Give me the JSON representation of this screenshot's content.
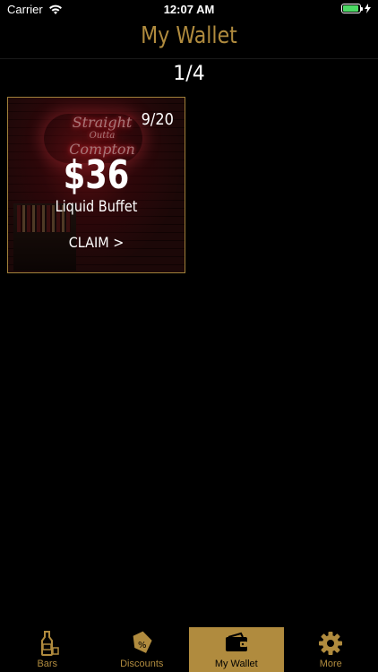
{
  "status_bar": {
    "carrier": "Carrier",
    "time": "12:07 AM"
  },
  "header": {
    "title": "My Wallet"
  },
  "pager": {
    "text": "1/4"
  },
  "coupon": {
    "count": "9/20",
    "amount": "$36",
    "name": "Liquid Buffet",
    "claim_label": "CLAIM >",
    "neon_line1": "Straight",
    "neon_line2": "Outta",
    "neon_line3": "Compton"
  },
  "tabs": [
    {
      "label": "Bars",
      "icon": "bottle-icon"
    },
    {
      "label": "Discounts",
      "icon": "discount-tag-icon"
    },
    {
      "label": "My Wallet",
      "icon": "wallet-icon"
    },
    {
      "label": "More",
      "icon": "gear-icon"
    }
  ],
  "colors": {
    "accent": "#b08b3e",
    "background": "#000000"
  }
}
